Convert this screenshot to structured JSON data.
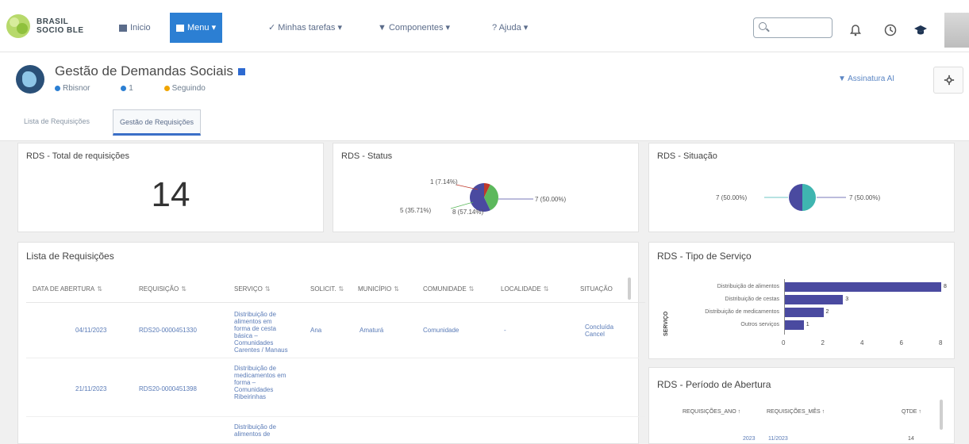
{
  "brand": {
    "line1": "BRASIL",
    "line2": "SOCIO BLE"
  },
  "nav": [
    {
      "label": "Inicio",
      "active": false
    },
    {
      "label": "Menu ▾",
      "active": true
    },
    {
      "label": "Minhas tarefas ▾",
      "active": false
    },
    {
      "label": "Componentes ▾",
      "active": false
    },
    {
      "label": "Ajuda ▾",
      "active": false
    }
  ],
  "header": {
    "title": "Gestão de Demandas Sociais",
    "meta_owner": "Rbisnor",
    "meta_count": "1",
    "meta_status": "Seguindo",
    "subscribe": "Assinatura AI"
  },
  "tabs": [
    {
      "label": "Lista de Requisições",
      "active": false
    },
    {
      "label": "Gestão de Requisições",
      "active": true
    }
  ],
  "cards": {
    "total_title": "RDS - Total de requisições",
    "total_value": "14",
    "status_title": "RDS - Status",
    "status_labels": {
      "a": "1 (7.14%)",
      "b": "5 (35.71%)",
      "c": "8 (57.14%)",
      "d": "7 (50.00%)"
    },
    "situacao_title": "RDS - Situação",
    "situacao_labels": {
      "left": "7 (50.00%)",
      "right": "7 (50.00%)"
    }
  },
  "requisicoes": {
    "title": "Lista de Requisições",
    "headers": [
      "DATA DE ABERTURA",
      "REQUISIÇÃO",
      "SERVIÇO",
      "SOLICIT.",
      "MUNICÍPIO",
      "COMUNIDADE",
      "LOCALIDADE",
      "SITUAÇÃO"
    ],
    "rows": [
      {
        "date": "04/11/2023",
        "req": "RDS20-0000451330",
        "service": "Distribuição de alimentos em forma de cesta básica – Comunidades Carentes / Manaus",
        "solic": "Ana",
        "municipio": "Amaturá",
        "comunidade": "Comunidade",
        "localidade": "-",
        "situacao": "Concluída Cancel"
      },
      {
        "date": "21/11/2023",
        "req": "RDS20-0000451398",
        "service": "Distribuição de medicamentos em forma – Comunidades Ribeirinhas",
        "solic": "",
        "municipio": "",
        "comunidade": "",
        "localidade": "",
        "situacao": ""
      },
      {
        "date": "",
        "req": "",
        "service": "Distribuição de alimentos de",
        "solic": "",
        "municipio": "",
        "comunidade": "",
        "localidade": "",
        "situacao": ""
      }
    ]
  },
  "tipo_servico": {
    "title": "RDS - Tipo de Serviço",
    "y_label": "SERVIÇO",
    "items": [
      {
        "label": "Distribuição de alimentos",
        "value": 8
      },
      {
        "label": "Distribuição de cestas",
        "value": 3
      },
      {
        "label": "Distribuição de medicamentos",
        "value": 2
      },
      {
        "label": "Outros serviços",
        "value": 1
      }
    ],
    "ticks": [
      "0",
      "2",
      "4",
      "6",
      "8"
    ]
  },
  "periodo": {
    "title": "RDS - Período de Abertura",
    "header_a": "REQUISIÇÕES_ANO ↑",
    "header_b": "REQUISIÇÕES_MÊS ↑",
    "header_c": "QTDE ↑",
    "row_a": "2023",
    "row_b": "11/2023",
    "row_c": "14"
  },
  "chart_data": [
    {
      "type": "pie",
      "title": "RDS - Status",
      "labels": [
        "1 (7.14%)",
        "5 (35.71%)",
        "8 (57.14%)"
      ],
      "values": [
        1,
        5,
        8
      ],
      "colors": [
        "#c0392b",
        "#5cb85c",
        "#4a4aa0"
      ]
    },
    {
      "type": "pie",
      "title": "RDS - Situação",
      "labels": [
        "7 (50.00%)",
        "7 (50.00%)"
      ],
      "values": [
        7,
        7
      ],
      "colors": [
        "#3fb5b0",
        "#4a4aa0"
      ]
    },
    {
      "type": "bar",
      "orientation": "horizontal",
      "title": "RDS - Tipo de Serviço",
      "categories": [
        "Distribuição de alimentos",
        "Distribuição de cestas",
        "Distribuição de medicamentos",
        "Outros serviços"
      ],
      "values": [
        8,
        3,
        2,
        1
      ],
      "xlim": [
        0,
        8
      ],
      "color": "#4a4aa0"
    }
  ]
}
